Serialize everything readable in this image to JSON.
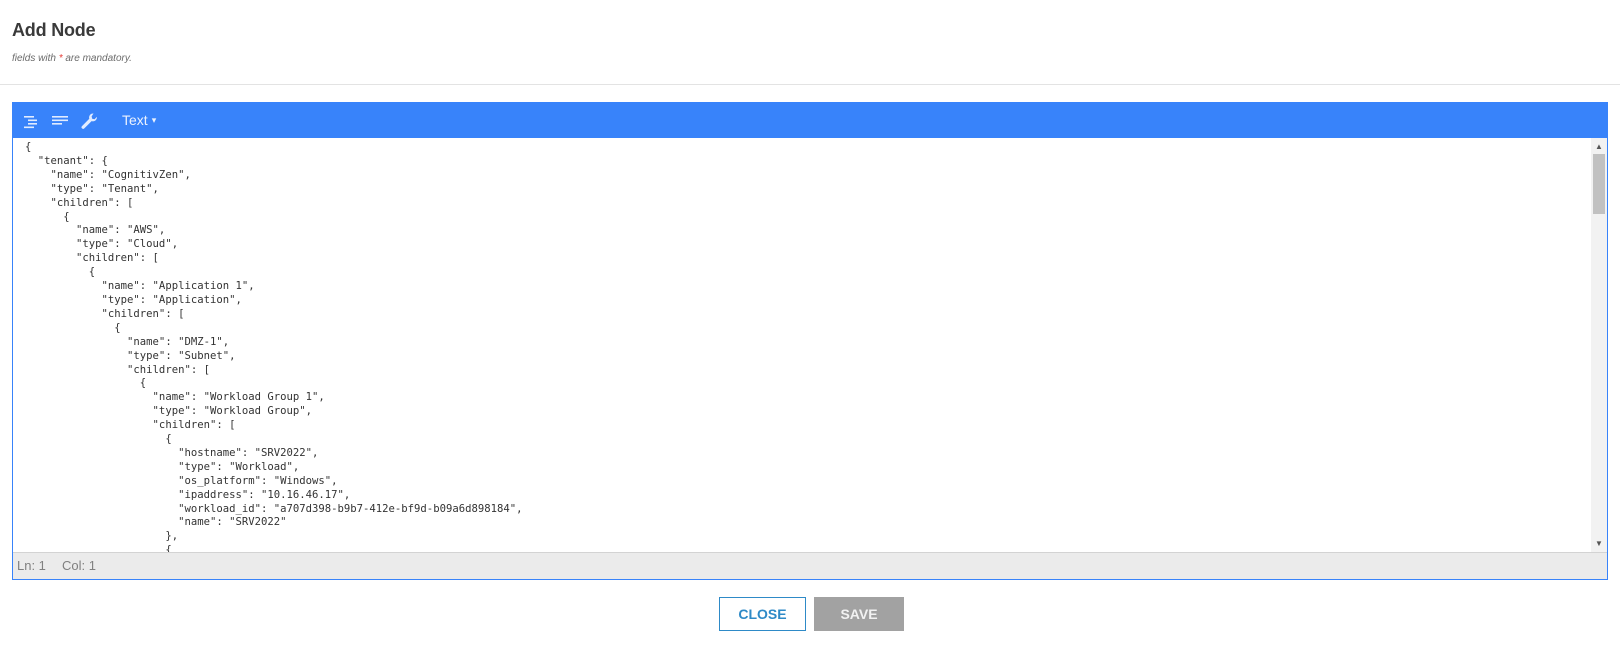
{
  "header": {
    "title": "Add Node",
    "subtitle_prefix": "fields with ",
    "subtitle_required_marker": "*",
    "subtitle_suffix": " are mandatory."
  },
  "editor": {
    "toolbar": {
      "format_icon": "format-indent-icon",
      "compact_icon": "compact-lines-icon",
      "repair_icon": "wrench-icon",
      "mode_label": "Text",
      "mode_caret": "▾"
    },
    "accent_color": "#3883fa",
    "content_lines": [
      "{",
      "  \"tenant\": {",
      "    \"name\": \"CognitivZen\",",
      "    \"type\": \"Tenant\",",
      "    \"children\": [",
      "      {",
      "        \"name\": \"AWS\",",
      "        \"type\": \"Cloud\",",
      "        \"children\": [",
      "          {",
      "            \"name\": \"Application 1\",",
      "            \"type\": \"Application\",",
      "            \"children\": [",
      "              {",
      "                \"name\": \"DMZ-1\",",
      "                \"type\": \"Subnet\",",
      "                \"children\": [",
      "                  {",
      "                    \"name\": \"Workload Group 1\",",
      "                    \"type\": \"Workload Group\",",
      "                    \"children\": [",
      "                      {",
      "                        \"hostname\": \"SRV2022\",",
      "                        \"type\": \"Workload\",",
      "                        \"os_platform\": \"Windows\",",
      "                        \"ipaddress\": \"10.16.46.17\",",
      "                        \"workload_id\": \"a707d398-b9b7-412e-bf9d-b09a6d898184\",",
      "                        \"name\": \"SRV2022\"",
      "                      },",
      "                      {"
    ],
    "status": {
      "line_label": "Ln: 1",
      "col_label": "Col: 1"
    },
    "scrollbar": {
      "up_glyph": "▲",
      "down_glyph": "▼"
    }
  },
  "footer": {
    "close_label": "CLOSE",
    "save_label": "SAVE"
  }
}
